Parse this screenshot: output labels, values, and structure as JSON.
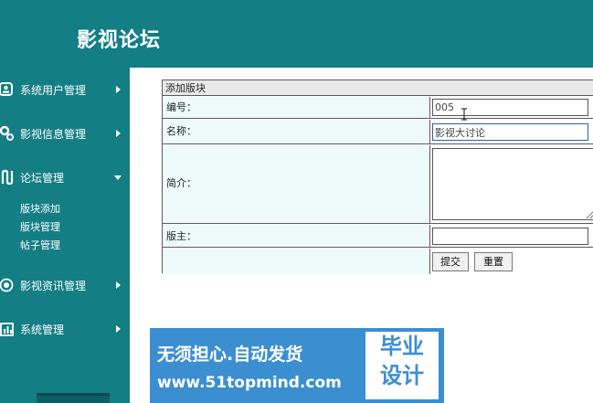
{
  "app": {
    "title": "影视论坛"
  },
  "sidebar": {
    "items": [
      {
        "label": "系统用户管理",
        "icon": "user-icon",
        "expanded": false
      },
      {
        "label": "影视信息管理",
        "icon": "gears-icon",
        "expanded": false
      },
      {
        "label": "论坛管理",
        "icon": "forum-icon",
        "expanded": true,
        "children": [
          "版块添加",
          "版块管理",
          "帖子管理"
        ]
      },
      {
        "label": "影视资讯管理",
        "icon": "news-icon",
        "expanded": false
      },
      {
        "label": "系统管理",
        "icon": "chart-icon",
        "expanded": false
      }
    ]
  },
  "form": {
    "title": "添加版块",
    "fields": {
      "code": {
        "label": "编号：",
        "value": "005"
      },
      "name": {
        "label": "名称：",
        "value": "影视大讨论"
      },
      "intro": {
        "label": "简介：",
        "value": ""
      },
      "moderator": {
        "label": "版主：",
        "value": ""
      }
    },
    "submit_label": "提交",
    "reset_label": "重置"
  },
  "watermark": {
    "line1": "无须担心.自动发货",
    "line2": "www.51topmind.com",
    "badge_line1": "毕业",
    "badge_line2": "设计"
  },
  "colors": {
    "primary": "#137e84",
    "row_bg": "#eefafa",
    "watermark": "#3b8fd0"
  }
}
